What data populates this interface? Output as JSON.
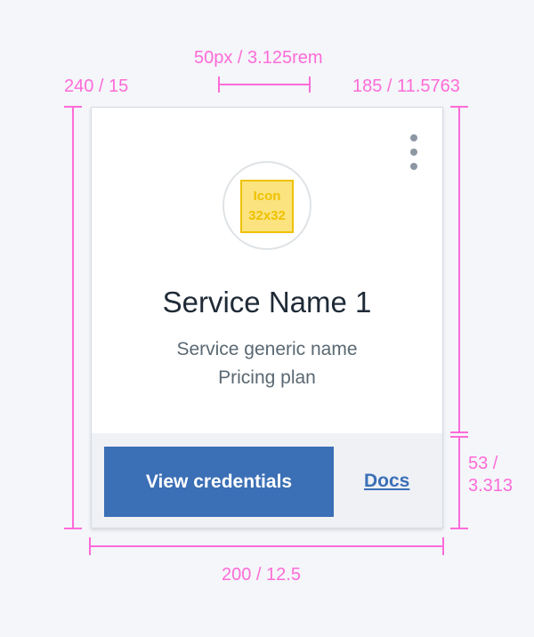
{
  "annotations": {
    "icon_margin": "50px / 3.125rem",
    "card_height": "240 / 15",
    "content_height": "185 / 11.5763",
    "footer_height_line1": "53 /",
    "footer_height_line2": "3.313",
    "card_width": "200 / 12.5"
  },
  "card": {
    "icon_label_line1": "Icon",
    "icon_label_line2": "32x32",
    "title": "Service Name 1",
    "subtitle_line1": "Service generic name",
    "subtitle_line2": "Pricing plan",
    "primary_button": "View credentials",
    "docs_link": "Docs"
  },
  "colors": {
    "annotation": "#ff6bd8",
    "primary": "#3b6fb6",
    "icon_fill": "#fbe37f",
    "icon_border": "#efc100"
  },
  "icons": {
    "menu": "overflow-menu-icon"
  }
}
